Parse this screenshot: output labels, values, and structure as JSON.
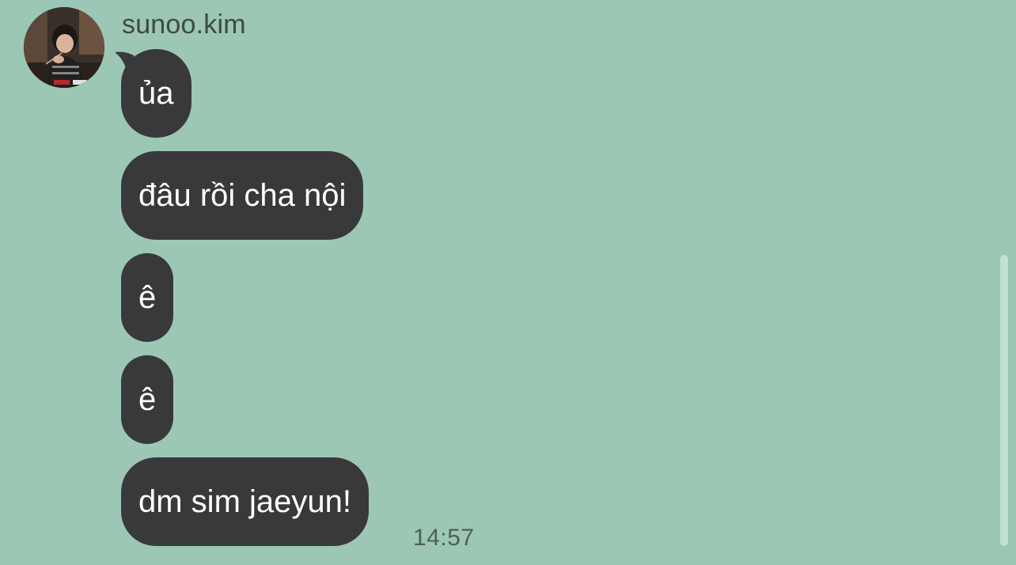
{
  "chat": {
    "sender_name": "sunoo.kim",
    "messages": [
      {
        "text": "ủa"
      },
      {
        "text": "đâu rồi cha nội"
      },
      {
        "text": "ê"
      },
      {
        "text": "ê"
      },
      {
        "text": "dm sim jaeyun!"
      }
    ],
    "last_timestamp": "14:57"
  },
  "colors": {
    "background": "#9cc7b4",
    "bubble": "#39393c",
    "bubble_text": "#ffffff",
    "meta_text": "#4f5f58"
  },
  "icons": {
    "avatar": "profile-photo"
  }
}
